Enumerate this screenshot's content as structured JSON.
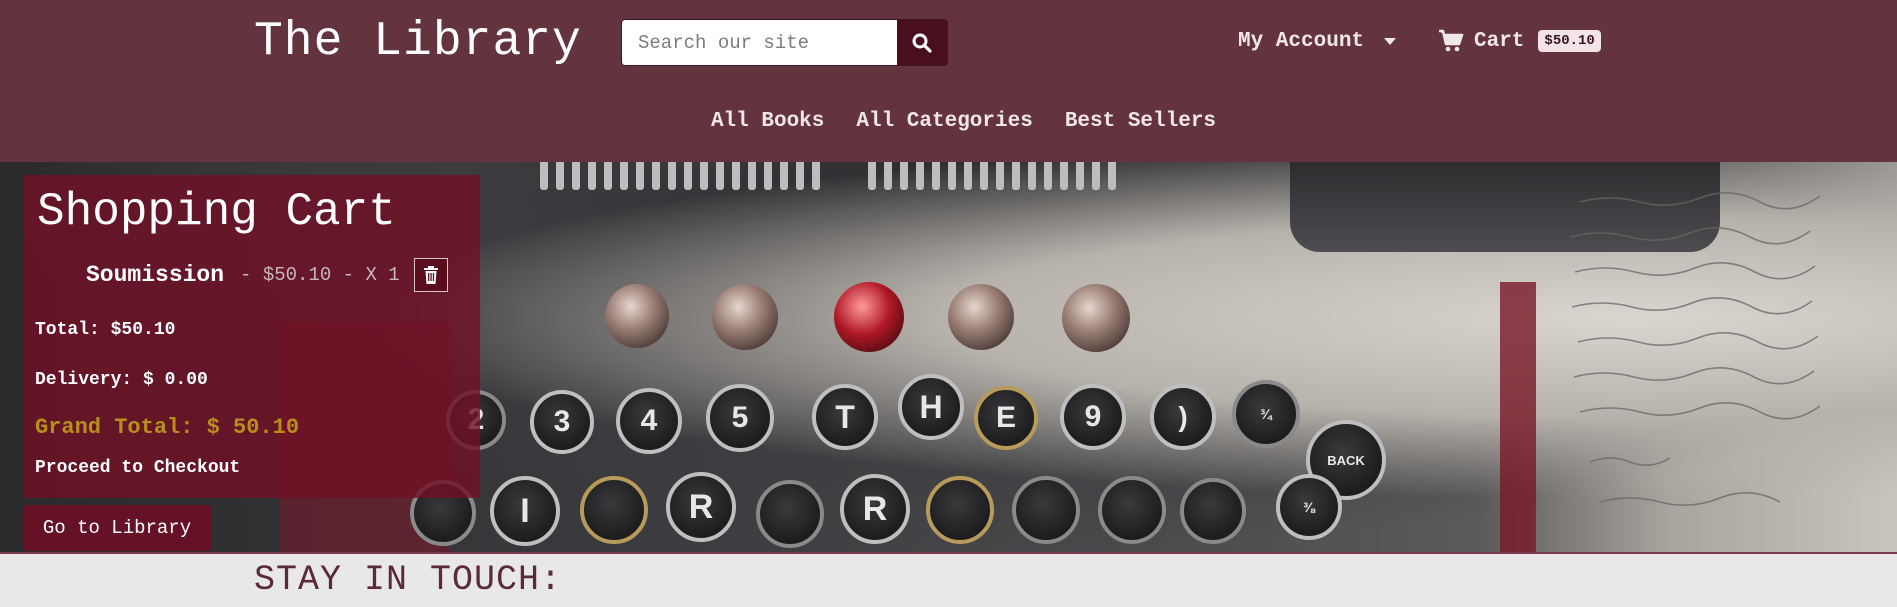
{
  "header": {
    "brand": "The Library",
    "search_placeholder": "Search our site",
    "search_icon": "search-icon",
    "account_label": "My Account",
    "cart_label": "Cart",
    "cart_total_badge": "$50.10",
    "nav": [
      "All Books",
      "All Categories",
      "Best Sellers"
    ]
  },
  "cart": {
    "title": "Shopping Cart",
    "item": {
      "name": "Soumission",
      "details": "- $50.10 - X 1",
      "delete_icon": "trash-icon"
    },
    "total": "Total: $50.10",
    "delivery": "Delivery: $ 0.00",
    "grand_total": "Grand Total: $ 50.10",
    "checkout": "Proceed to Checkout",
    "library_button": "Go to Library"
  },
  "footer": {
    "title": "STAY IN TOUCH:"
  },
  "colors": {
    "header_bg": "#633440",
    "cart_panel": "#701024",
    "grand_total": "#b88f1a",
    "badge_bg": "#f1e4e6"
  }
}
